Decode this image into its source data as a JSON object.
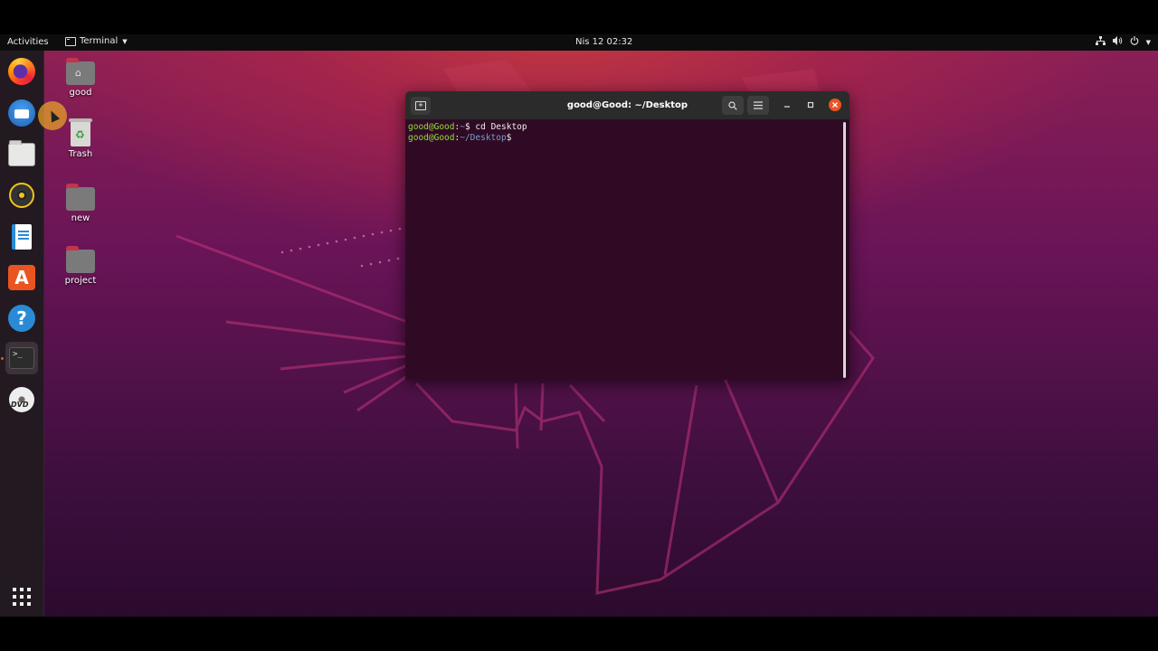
{
  "topbar": {
    "activities": "Activities",
    "app_name": "Terminal",
    "clock": "Nis 12  02:32"
  },
  "dock": {
    "items": [
      {
        "name": "firefox",
        "icon": "firefox-icon"
      },
      {
        "name": "thunderbird",
        "icon": "thunderbird-icon"
      },
      {
        "name": "files",
        "icon": "files-icon"
      },
      {
        "name": "rhythmbox",
        "icon": "rhythmbox-icon"
      },
      {
        "name": "libreoffice-writer",
        "icon": "writer-icon"
      },
      {
        "name": "ubuntu-software",
        "icon": "software-icon",
        "glyph": "A"
      },
      {
        "name": "help",
        "icon": "help-icon",
        "glyph": "?"
      },
      {
        "name": "terminal",
        "icon": "terminal-icon",
        "glyph": ">_",
        "running": true
      },
      {
        "name": "dvd",
        "icon": "dvd-icon",
        "glyph": "DVD"
      }
    ]
  },
  "desktop_icons": [
    {
      "label": "good",
      "type": "home-folder"
    },
    {
      "label": "Trash",
      "type": "trash"
    },
    {
      "label": "new",
      "type": "folder"
    },
    {
      "label": "project",
      "type": "folder"
    }
  ],
  "terminal": {
    "title": "good@Good: ~/Desktop",
    "lines": [
      {
        "user": "good@Good",
        "sep": ":",
        "path": "~",
        "prompt": "$ ",
        "cmd": "cd Desktop"
      },
      {
        "user": "good@Good",
        "sep": ":",
        "path": "~/Desktop",
        "prompt": "$",
        "cmd": ""
      }
    ]
  },
  "colors": {
    "accent": "#e95420",
    "prompt_user": "#8ae234",
    "prompt_path": "#729fcf",
    "terminal_bg": "#300a24"
  }
}
